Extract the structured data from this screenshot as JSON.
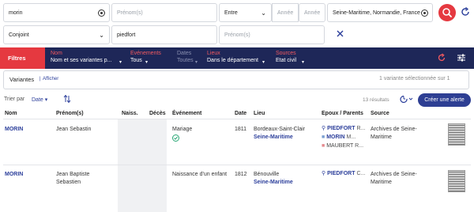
{
  "search": {
    "surname_value": "morin",
    "firstname_placeholder": "Prénom(s)",
    "date_mode": "Entre",
    "year_from_placeholder": "Année",
    "year_to_placeholder": "Année",
    "place_value": "Seine-Maritime, Normandie, France",
    "relation_value": "Conjoint",
    "relation_surname_value": "piedfort",
    "relation_firstname_placeholder": "Prénom(s)"
  },
  "filters": {
    "toggle_label": "Filtres",
    "items": [
      {
        "label": "Nom",
        "value": "Nom et ses variantes p..."
      },
      {
        "label": "Evénements",
        "value": "Tous"
      },
      {
        "label": "Dates",
        "value": "Toutes"
      },
      {
        "label": "Lieux",
        "value": "Dans le département"
      },
      {
        "label": "Sources",
        "value": "Etat civil"
      }
    ]
  },
  "variants": {
    "title": "Variantes",
    "show_link": "Afficher",
    "selection_status": "1 variante sélectionnée sur 1"
  },
  "results_bar": {
    "sort_label": "Trier par",
    "sort_value": "Date",
    "count": "13 résultats",
    "alert_button": "Créer une alerte"
  },
  "table": {
    "headers": [
      "Nom",
      "Prénom(s)",
      "Naiss.",
      "Décès",
      "Événement",
      "Date",
      "Lieu",
      "Epoux / Parents",
      "Source"
    ],
    "rows": [
      {
        "nom": "MORIN",
        "prenom": "Jean Sebastin",
        "evenement": "Mariage",
        "date": "1811",
        "lieu_ville": "Bordeaux-Saint-Clair",
        "lieu_dept": "Seine-Maritime",
        "relations": [
          {
            "surname": "PIEDFORT",
            "given": "R..."
          },
          {
            "surname": "MORIN",
            "given": "M..."
          },
          {
            "surname": "MAUBERT",
            "given": "R..."
          }
        ],
        "source": "Archives de Seine-Maritime"
      },
      {
        "nom": "MORIN",
        "prenom": "Jean Baptiste Sebastien",
        "evenement": "Naissance d'un enfant",
        "date": "1812",
        "lieu_ville": "Bénouville",
        "lieu_dept": "Seine-Maritime",
        "relations": [
          {
            "surname": "PIEDFORT",
            "given": "C..."
          }
        ],
        "source": "Archives de Seine-Maritime"
      }
    ]
  },
  "colors": {
    "brand_red": "#e53940",
    "navy": "#1e2758",
    "link_blue": "#2c3f9b",
    "success_green": "#2aa876"
  }
}
